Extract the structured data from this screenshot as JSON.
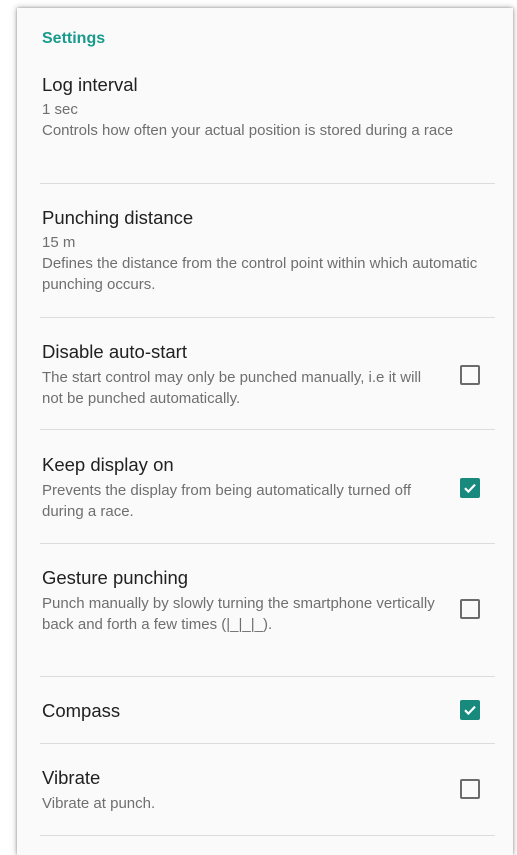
{
  "settings": {
    "section_title": "Settings",
    "log_interval": {
      "title": "Log interval",
      "value": "1 sec",
      "summary": "Controls how often your actual position is stored during a race"
    },
    "punching_distance": {
      "title": "Punching distance",
      "value": "15 m",
      "summary": "Defines the distance from the control point within which automatic punching occurs."
    },
    "disable_auto_start": {
      "title": "Disable auto-start",
      "summary": "The start control may only be punched manually, i.e it will not be punched automatically.",
      "checked": false
    },
    "keep_display_on": {
      "title": "Keep display on",
      "summary": "Prevents the display from being automatically turned off during a race.",
      "checked": true
    },
    "gesture_punching": {
      "title": "Gesture punching",
      "summary": "Punch manually by slowly turning the smartphone vertically back and forth a few times (|_|_|_).",
      "checked": false
    },
    "compass": {
      "title": "Compass",
      "checked": true
    },
    "vibrate": {
      "title": "Vibrate",
      "summary": "Vibrate at punch.",
      "checked": false
    }
  },
  "colors": {
    "accent": "#17897d",
    "section_title": "#1a9a8c"
  },
  "icons": {
    "check": "check-icon"
  }
}
